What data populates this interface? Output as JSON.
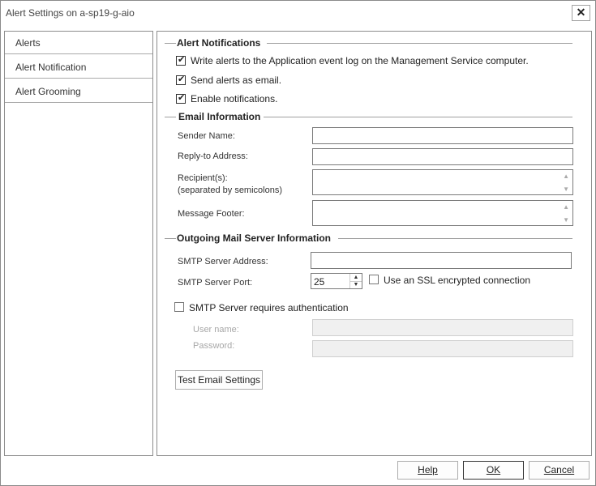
{
  "window": {
    "title": "Alert Settings on a-sp19-g-aio",
    "close_glyph": "✕"
  },
  "sidebar": {
    "items": [
      {
        "label": "Alerts"
      },
      {
        "label": "Alert Notification"
      },
      {
        "label": "Alert Grooming"
      }
    ]
  },
  "alert_notifications": {
    "title": "Alert Notifications",
    "options": [
      {
        "label": "Write alerts to the Application event log on the Management Service computer.",
        "checked": true
      },
      {
        "label": "Send alerts as email.",
        "checked": true
      },
      {
        "label": "Enable notifications.",
        "checked": true
      }
    ]
  },
  "email_information": {
    "title": "Email Information",
    "sender_name_label": "Sender Name:",
    "sender_name_value": "",
    "reply_to_label": "Reply-to Address:",
    "reply_to_value": "",
    "recipients_label": "Recipient(s):",
    "recipients_hint": "(separated by semicolons)",
    "recipients_value": "",
    "footer_label": "Message Footer:",
    "footer_value": ""
  },
  "outgoing_mail": {
    "title": "Outgoing Mail Server Information",
    "smtp_address_label": "SMTP Server Address:",
    "smtp_address_value": "",
    "smtp_port_label": "SMTP Server Port:",
    "smtp_port_value": "25",
    "ssl_label": "Use an SSL encrypted connection",
    "ssl_checked": false,
    "auth_label": "SMTP Server requires authentication",
    "auth_checked": false,
    "username_label": "User name:",
    "password_label": "Password:",
    "test_button": "Test Email Settings"
  },
  "footer_buttons": {
    "help": "Help",
    "ok": "OK",
    "cancel": "Cancel"
  },
  "icons": {
    "checkmark": "checkmark-icon",
    "spin_up": "arrow-up-icon",
    "spin_down": "arrow-down-icon"
  }
}
